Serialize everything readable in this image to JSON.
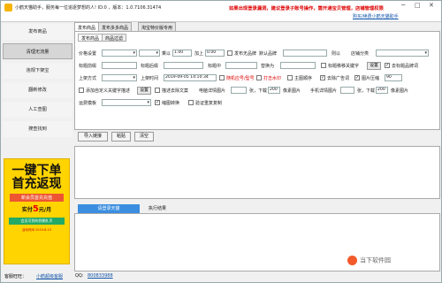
{
  "titlebar": {
    "title": "小鹤天猫助手，服务每一位追逐梦想的人! ID:0 ，版本：1.0.7106.31474",
    "warning": "如果出现登录漏洞，建议登录子账号操作，需开通宝贝管理，店铺管理权限",
    "buy_link": "购买/续费小鹤天猫助手"
  },
  "sidebar": {
    "items": [
      {
        "label": "发布商品"
      },
      {
        "label": "清理无流量"
      },
      {
        "label": "违规下架宝"
      },
      {
        "label": "翻新修改"
      },
      {
        "label": "人工查图"
      },
      {
        "label": "搜查找到"
      }
    ]
  },
  "ad": {
    "line1": "一键下单",
    "line2": "首充返现",
    "line3": "新会员首充充值",
    "line4": "实付",
    "price": "5",
    "unit": "元/月",
    "line5": "会员可到的到期礼币",
    "line6": "活动时间 2019-8-15"
  },
  "main": {
    "tabs": [
      {
        "label": "发布商品"
      },
      {
        "label": "发布多多商品"
      },
      {
        "label": "淘宝特价版专用"
      }
    ],
    "subtabs": [
      {
        "label": "发布商品"
      },
      {
        "label": "商品过滤"
      }
    ],
    "row1": {
      "price_label": "价格设置",
      "inc_label": "乘以",
      "inc_val": "1.00",
      "add_label": "加上",
      "add_val": "0.00",
      "category_label": "发布无品牌",
      "default_label": "默认品牌",
      "ship_label": "则以",
      "store_label": "店铺分类"
    },
    "row2": {
      "title_label": "标题前缀",
      "suffix_label": "标题后缀",
      "mid_label": "标题中",
      "replace_label": "替换为",
      "title_move": "标题移移关键字",
      "set_btn": "设置",
      "remove_label": "去标题品牌词"
    },
    "row3": {
      "up_label": "上架方式",
      "time_label": "上架时间",
      "time_val": "2019-09-05 14:10:34",
      "rand_label": "随机应号/型号",
      "bold_label": "打击水印",
      "main_img": "主图顺序",
      "first_ad": "去除广告词",
      "quality_label": "图片压缩",
      "quality_val": "90"
    },
    "row4": {
      "custom_label": "添加自定义关键字描述",
      "set_btn": "设置",
      "desc_label": "描述去除文案",
      "detail_label": "电脑详情图片",
      "download_label": "张，下载",
      "download_val": "200",
      "px_label": "像素图片",
      "mobile_label": "手机详情图片",
      "px2": "200"
    },
    "row5": {
      "ship_tpl": "运费模板",
      "zoom_label": "缩图转换",
      "verify_label": "验证重复复制"
    },
    "actions": {
      "import": "导入链接",
      "paste": "粘贴",
      "clear": "清空"
    },
    "result_tabs": {
      "auth": "请登录天猫",
      "result": "执行结果"
    }
  },
  "footer": {
    "qq_label": "客服旺旺：",
    "qq_name": "小鹤超级客服",
    "qq2_label": "QQ:",
    "qq2": "800833988"
  },
  "watermark": "当下软件园"
}
